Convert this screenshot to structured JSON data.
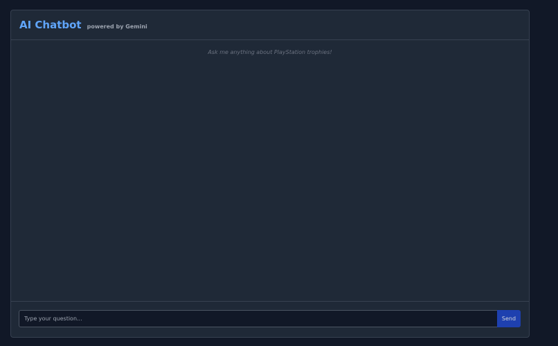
{
  "header": {
    "title": "AI Chatbot",
    "subtitle": "powered by Gemini"
  },
  "messages": {
    "empty_hint": "Ask me anything about PlayStation trophies!"
  },
  "input": {
    "placeholder": "Type your question...",
    "value": "",
    "send_label": "Send"
  },
  "colors": {
    "page_background": "#111827",
    "panel_background": "#1f2937",
    "accent": "#60a5fa",
    "send_button": "#1e40af"
  }
}
